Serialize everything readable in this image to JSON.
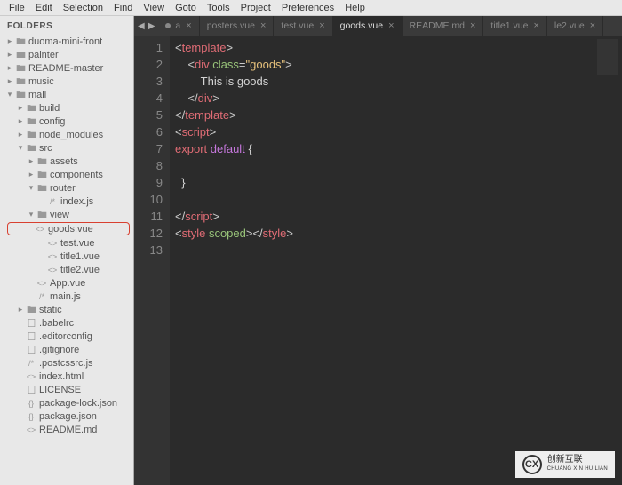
{
  "menu": [
    "File",
    "Edit",
    "Selection",
    "Find",
    "View",
    "Goto",
    "Tools",
    "Project",
    "Preferences",
    "Help"
  ],
  "sidebar": {
    "header": "FOLDERS",
    "items": [
      {
        "indent": 0,
        "arrow": "▸",
        "icon": "folder",
        "label": "duoma-mini-front"
      },
      {
        "indent": 0,
        "arrow": "▸",
        "icon": "folder",
        "label": "painter"
      },
      {
        "indent": 0,
        "arrow": "▸",
        "icon": "folder",
        "label": "README-master"
      },
      {
        "indent": 0,
        "arrow": "▸",
        "icon": "folder",
        "label": "music"
      },
      {
        "indent": 0,
        "arrow": "▾",
        "icon": "folder-open",
        "label": "mall"
      },
      {
        "indent": 1,
        "arrow": "▸",
        "icon": "folder",
        "label": "build"
      },
      {
        "indent": 1,
        "arrow": "▸",
        "icon": "folder",
        "label": "config"
      },
      {
        "indent": 1,
        "arrow": "▸",
        "icon": "folder",
        "label": "node_modules"
      },
      {
        "indent": 1,
        "arrow": "▾",
        "icon": "folder-open",
        "label": "src"
      },
      {
        "indent": 2,
        "arrow": "▸",
        "icon": "folder",
        "label": "assets"
      },
      {
        "indent": 2,
        "arrow": "▸",
        "icon": "folder",
        "label": "components"
      },
      {
        "indent": 2,
        "arrow": "▾",
        "icon": "folder-open",
        "label": "router"
      },
      {
        "indent": 3,
        "arrow": "",
        "icon": "file-js",
        "label": "index.js"
      },
      {
        "indent": 2,
        "arrow": "▾",
        "icon": "folder-open",
        "label": "view"
      },
      {
        "indent": 3,
        "arrow": "",
        "icon": "file-vue",
        "label": "goods.vue",
        "highlight": true
      },
      {
        "indent": 3,
        "arrow": "",
        "icon": "file-vue",
        "label": "test.vue"
      },
      {
        "indent": 3,
        "arrow": "",
        "icon": "file-vue",
        "label": "title1.vue"
      },
      {
        "indent": 3,
        "arrow": "",
        "icon": "file-vue",
        "label": "title2.vue"
      },
      {
        "indent": 2,
        "arrow": "",
        "icon": "file-vue",
        "label": "App.vue"
      },
      {
        "indent": 2,
        "arrow": "",
        "icon": "file-js",
        "label": "main.js"
      },
      {
        "indent": 1,
        "arrow": "▸",
        "icon": "folder",
        "label": "static"
      },
      {
        "indent": 1,
        "arrow": "",
        "icon": "file",
        "label": ".babelrc"
      },
      {
        "indent": 1,
        "arrow": "",
        "icon": "file",
        "label": ".editorconfig"
      },
      {
        "indent": 1,
        "arrow": "",
        "icon": "file",
        "label": ".gitignore"
      },
      {
        "indent": 1,
        "arrow": "",
        "icon": "file-js",
        "label": ".postcssrc.js"
      },
      {
        "indent": 1,
        "arrow": "",
        "icon": "file-vue",
        "label": "index.html"
      },
      {
        "indent": 1,
        "arrow": "",
        "icon": "file",
        "label": "LICENSE"
      },
      {
        "indent": 1,
        "arrow": "",
        "icon": "file-json",
        "label": "package-lock.json"
      },
      {
        "indent": 1,
        "arrow": "",
        "icon": "file-json",
        "label": "package.json"
      },
      {
        "indent": 1,
        "arrow": "",
        "icon": "file-vue",
        "label": "README.md"
      }
    ]
  },
  "tabs": [
    {
      "label": "a",
      "dot": true,
      "active": false
    },
    {
      "label": "posters.vue",
      "dot": false,
      "active": false
    },
    {
      "label": "test.vue",
      "dot": false,
      "active": false
    },
    {
      "label": "goods.vue",
      "dot": false,
      "active": true
    },
    {
      "label": "README.md",
      "dot": false,
      "active": false
    },
    {
      "label": "title1.vue",
      "dot": false,
      "active": false
    },
    {
      "label": "le2.vue",
      "dot": false,
      "active": false
    }
  ],
  "code": {
    "lines": [
      {
        "n": 1,
        "html": "<span class='c-punc'>&lt;</span><span class='c-tag'>template</span><span class='c-punc'>&gt;</span>"
      },
      {
        "n": 2,
        "html": "    <span class='c-punc'>&lt;</span><span class='c-tag'>div</span> <span class='c-attr'>class</span><span class='c-punc'>=</span><span class='c-str'>\"goods\"</span><span class='c-punc'>&gt;</span>"
      },
      {
        "n": 3,
        "html": "        <span class='c-text'>This is goods</span>"
      },
      {
        "n": 4,
        "html": "    <span class='c-punc'>&lt;/</span><span class='c-tag'>div</span><span class='c-punc'>&gt;</span>"
      },
      {
        "n": 5,
        "html": "<span class='c-punc'>&lt;/</span><span class='c-tag'>template</span><span class='c-punc'>&gt;</span>"
      },
      {
        "n": 6,
        "html": "<span class='c-punc'>&lt;</span><span class='c-tag'>script</span><span class='c-punc'>&gt;</span>"
      },
      {
        "n": 7,
        "html": "<span class='c-tag'>export</span> <span class='c-kw'>default</span> <span class='c-plain'>{</span>"
      },
      {
        "n": 8,
        "html": ""
      },
      {
        "n": 9,
        "html": "  <span class='c-plain'>}</span>"
      },
      {
        "n": 10,
        "html": ""
      },
      {
        "n": 11,
        "html": "<span class='c-punc'>&lt;/</span><span class='c-tag'>script</span><span class='c-punc'>&gt;</span>"
      },
      {
        "n": 12,
        "html": "<span class='c-punc'>&lt;</span><span class='c-tag'>style</span> <span class='c-attr'>scoped</span><span class='c-punc'>&gt;&lt;/</span><span class='c-tag'>style</span><span class='c-punc'>&gt;</span>"
      },
      {
        "n": 13,
        "html": ""
      }
    ]
  },
  "watermark": {
    "logo": "CX",
    "line1": "创新互联",
    "line2": "CHUANG XIN HU LIAN"
  }
}
